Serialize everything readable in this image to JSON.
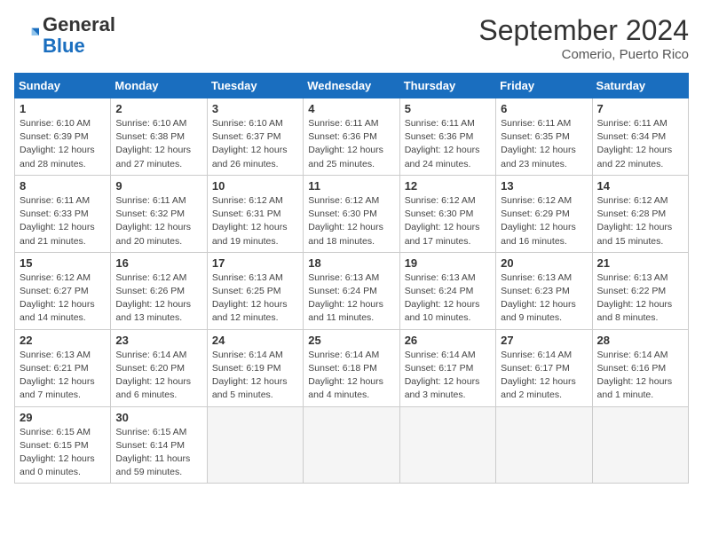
{
  "header": {
    "logo_general": "General",
    "logo_blue": "Blue",
    "title": "September 2024",
    "location": "Comerio, Puerto Rico"
  },
  "days_of_week": [
    "Sunday",
    "Monday",
    "Tuesday",
    "Wednesday",
    "Thursday",
    "Friday",
    "Saturday"
  ],
  "weeks": [
    [
      {
        "day": 1,
        "info": "Sunrise: 6:10 AM\nSunset: 6:39 PM\nDaylight: 12 hours\nand 28 minutes."
      },
      {
        "day": 2,
        "info": "Sunrise: 6:10 AM\nSunset: 6:38 PM\nDaylight: 12 hours\nand 27 minutes."
      },
      {
        "day": 3,
        "info": "Sunrise: 6:10 AM\nSunset: 6:37 PM\nDaylight: 12 hours\nand 26 minutes."
      },
      {
        "day": 4,
        "info": "Sunrise: 6:11 AM\nSunset: 6:36 PM\nDaylight: 12 hours\nand 25 minutes."
      },
      {
        "day": 5,
        "info": "Sunrise: 6:11 AM\nSunset: 6:36 PM\nDaylight: 12 hours\nand 24 minutes."
      },
      {
        "day": 6,
        "info": "Sunrise: 6:11 AM\nSunset: 6:35 PM\nDaylight: 12 hours\nand 23 minutes."
      },
      {
        "day": 7,
        "info": "Sunrise: 6:11 AM\nSunset: 6:34 PM\nDaylight: 12 hours\nand 22 minutes."
      }
    ],
    [
      {
        "day": 8,
        "info": "Sunrise: 6:11 AM\nSunset: 6:33 PM\nDaylight: 12 hours\nand 21 minutes."
      },
      {
        "day": 9,
        "info": "Sunrise: 6:11 AM\nSunset: 6:32 PM\nDaylight: 12 hours\nand 20 minutes."
      },
      {
        "day": 10,
        "info": "Sunrise: 6:12 AM\nSunset: 6:31 PM\nDaylight: 12 hours\nand 19 minutes."
      },
      {
        "day": 11,
        "info": "Sunrise: 6:12 AM\nSunset: 6:30 PM\nDaylight: 12 hours\nand 18 minutes."
      },
      {
        "day": 12,
        "info": "Sunrise: 6:12 AM\nSunset: 6:30 PM\nDaylight: 12 hours\nand 17 minutes."
      },
      {
        "day": 13,
        "info": "Sunrise: 6:12 AM\nSunset: 6:29 PM\nDaylight: 12 hours\nand 16 minutes."
      },
      {
        "day": 14,
        "info": "Sunrise: 6:12 AM\nSunset: 6:28 PM\nDaylight: 12 hours\nand 15 minutes."
      }
    ],
    [
      {
        "day": 15,
        "info": "Sunrise: 6:12 AM\nSunset: 6:27 PM\nDaylight: 12 hours\nand 14 minutes."
      },
      {
        "day": 16,
        "info": "Sunrise: 6:12 AM\nSunset: 6:26 PM\nDaylight: 12 hours\nand 13 minutes."
      },
      {
        "day": 17,
        "info": "Sunrise: 6:13 AM\nSunset: 6:25 PM\nDaylight: 12 hours\nand 12 minutes."
      },
      {
        "day": 18,
        "info": "Sunrise: 6:13 AM\nSunset: 6:24 PM\nDaylight: 12 hours\nand 11 minutes."
      },
      {
        "day": 19,
        "info": "Sunrise: 6:13 AM\nSunset: 6:24 PM\nDaylight: 12 hours\nand 10 minutes."
      },
      {
        "day": 20,
        "info": "Sunrise: 6:13 AM\nSunset: 6:23 PM\nDaylight: 12 hours\nand 9 minutes."
      },
      {
        "day": 21,
        "info": "Sunrise: 6:13 AM\nSunset: 6:22 PM\nDaylight: 12 hours\nand 8 minutes."
      }
    ],
    [
      {
        "day": 22,
        "info": "Sunrise: 6:13 AM\nSunset: 6:21 PM\nDaylight: 12 hours\nand 7 minutes."
      },
      {
        "day": 23,
        "info": "Sunrise: 6:14 AM\nSunset: 6:20 PM\nDaylight: 12 hours\nand 6 minutes."
      },
      {
        "day": 24,
        "info": "Sunrise: 6:14 AM\nSunset: 6:19 PM\nDaylight: 12 hours\nand 5 minutes."
      },
      {
        "day": 25,
        "info": "Sunrise: 6:14 AM\nSunset: 6:18 PM\nDaylight: 12 hours\nand 4 minutes."
      },
      {
        "day": 26,
        "info": "Sunrise: 6:14 AM\nSunset: 6:17 PM\nDaylight: 12 hours\nand 3 minutes."
      },
      {
        "day": 27,
        "info": "Sunrise: 6:14 AM\nSunset: 6:17 PM\nDaylight: 12 hours\nand 2 minutes."
      },
      {
        "day": 28,
        "info": "Sunrise: 6:14 AM\nSunset: 6:16 PM\nDaylight: 12 hours\nand 1 minute."
      }
    ],
    [
      {
        "day": 29,
        "info": "Sunrise: 6:15 AM\nSunset: 6:15 PM\nDaylight: 12 hours\nand 0 minutes."
      },
      {
        "day": 30,
        "info": "Sunrise: 6:15 AM\nSunset: 6:14 PM\nDaylight: 11 hours\nand 59 minutes."
      },
      null,
      null,
      null,
      null,
      null
    ]
  ]
}
